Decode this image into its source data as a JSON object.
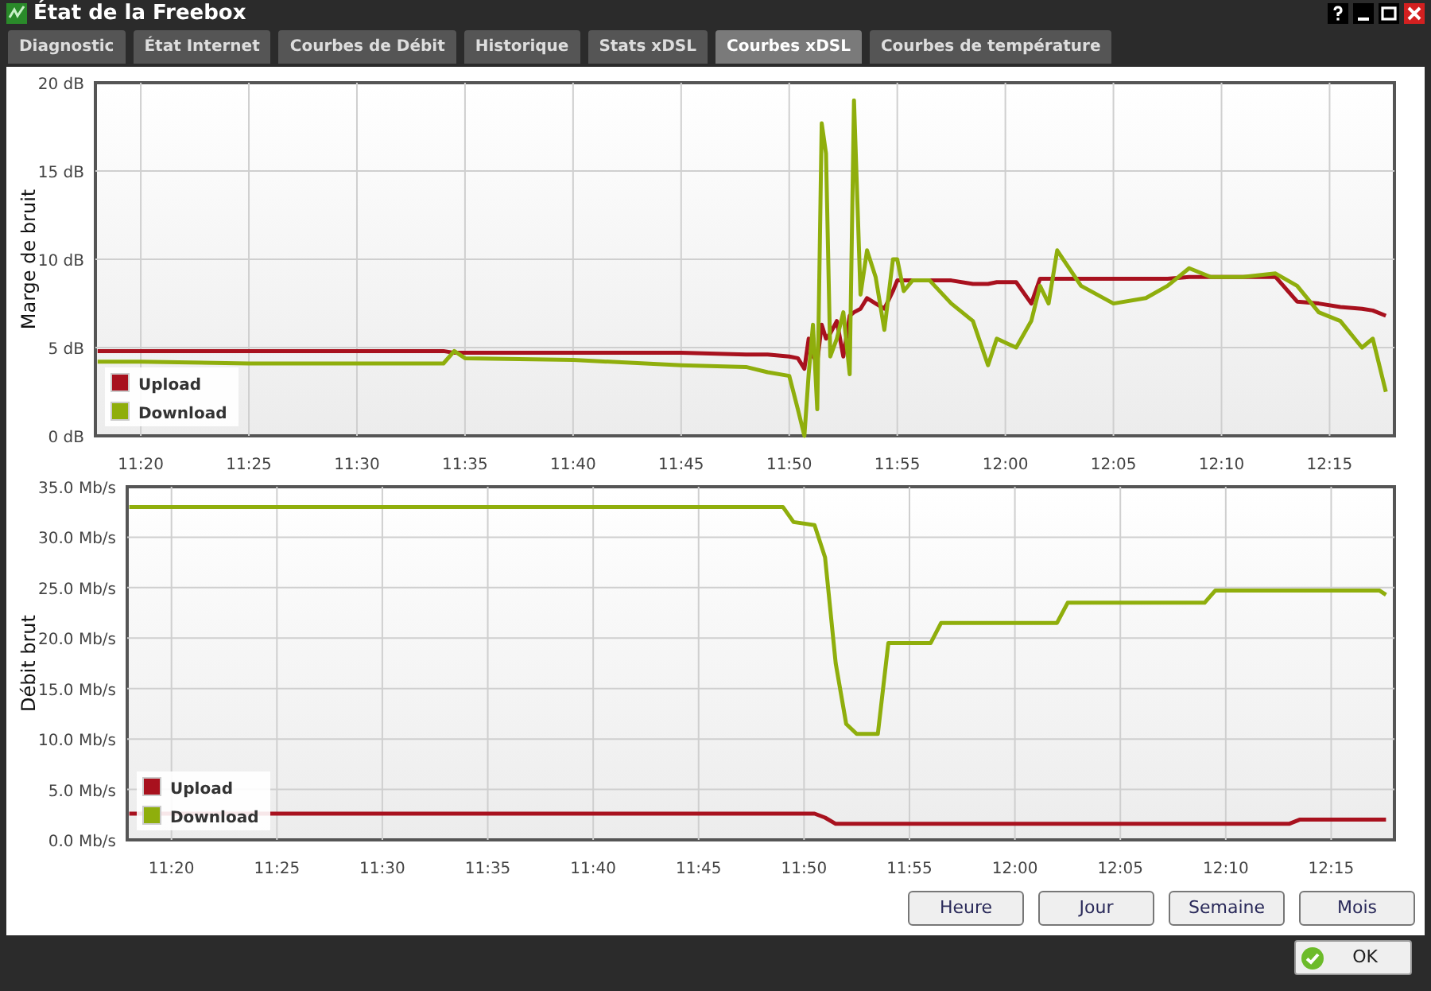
{
  "window": {
    "title": "État de la Freebox"
  },
  "tabs": [
    {
      "label": "Diagnostic",
      "selected": false
    },
    {
      "label": "État Internet",
      "selected": false
    },
    {
      "label": "Courbes de Débit",
      "selected": false
    },
    {
      "label": "Historique",
      "selected": false
    },
    {
      "label": "Stats xDSL",
      "selected": false
    },
    {
      "label": "Courbes xDSL",
      "selected": true
    },
    {
      "label": "Courbes de température",
      "selected": false
    }
  ],
  "charts": [
    {
      "chart_data": {
        "type": "line",
        "grid": true,
        "legend": true,
        "ylabel": "Marge de bruit",
        "xlim": [
          677.9,
          738
        ],
        "ylim": [
          0,
          20
        ],
        "yticks": [
          {
            "value": 0,
            "label": "0 dB"
          },
          {
            "value": 5,
            "label": "5 dB"
          },
          {
            "value": 10,
            "label": "10 dB"
          },
          {
            "value": 15,
            "label": "15 dB"
          },
          {
            "value": 20,
            "label": "20 dB"
          }
        ],
        "xticks": [
          {
            "value": 680,
            "label": "11:20"
          },
          {
            "value": 685,
            "label": "11:25"
          },
          {
            "value": 690,
            "label": "11:30"
          },
          {
            "value": 695,
            "label": "11:35"
          },
          {
            "value": 700,
            "label": "11:40"
          },
          {
            "value": 705,
            "label": "11:45"
          },
          {
            "value": 710,
            "label": "11:50"
          },
          {
            "value": 715,
            "label": "11:55"
          },
          {
            "value": 720,
            "label": "12:00"
          },
          {
            "value": 725,
            "label": "12:05"
          },
          {
            "value": 730,
            "label": "12:10"
          },
          {
            "value": 735,
            "label": "12:15"
          }
        ],
        "x": [
          678,
          680,
          685,
          690,
          694,
          694.5,
          695,
          700,
          705,
          708,
          709,
          710,
          710.4,
          710.7,
          710.9,
          711.1,
          711.3,
          711.5,
          711.7,
          711.9,
          712.2,
          712.5,
          712.8,
          713,
          713.3,
          713.6,
          714,
          714.4,
          714.8,
          715,
          715.3,
          715.7,
          716.5,
          717.5,
          718.5,
          719.2,
          719.6,
          720.5,
          721.2,
          721.6,
          722,
          722.4,
          723.5,
          725,
          726.5,
          727.5,
          728.5,
          729.5,
          731,
          732.5,
          733.5,
          734.5,
          735.5,
          736.5,
          737,
          737.6
        ],
        "series": [
          {
            "name": "Upload",
            "color": "#a8111e",
            "values": [
              4.8,
              4.8,
              4.8,
              4.8,
              4.8,
              4.7,
              4.7,
              4.7,
              4.7,
              4.6,
              4.6,
              4.5,
              4.4,
              3.8,
              5.5,
              4.5,
              4.2,
              6.3,
              5.5,
              5.8,
              6.5,
              4.5,
              6.8,
              7,
              7.2,
              7.8,
              7.5,
              7.2,
              8.2,
              8.8,
              8.8,
              8.8,
              8.8,
              8.8,
              8.6,
              8.6,
              8.7,
              8.7,
              7.5,
              8.9,
              8.9,
              8.9,
              8.9,
              8.9,
              8.9,
              8.9,
              9,
              9,
              9,
              9,
              7.6,
              7.5,
              7.3,
              7.2,
              7.1,
              6.8
            ]
          },
          {
            "name": "Download",
            "color": "#8fae0c",
            "values": [
              4.2,
              4.2,
              4.1,
              4.1,
              4.1,
              4.8,
              4.4,
              4.3,
              4,
              3.9,
              3.6,
              3.4,
              1.5,
              0,
              3.5,
              6.3,
              1.5,
              17.7,
              16,
              4.5,
              5.5,
              7,
              3.5,
              19,
              8,
              10.5,
              9,
              6,
              10,
              10,
              8.2,
              8.8,
              8.8,
              7.5,
              6.5,
              4,
              5.5,
              5,
              6.5,
              8.5,
              7.5,
              10.5,
              8.5,
              7.5,
              7.8,
              8.5,
              9.5,
              9,
              9,
              9.2,
              8.5,
              7,
              6.5,
              5,
              5.5,
              2.5
            ]
          }
        ]
      }
    },
    {
      "chart_data": {
        "type": "line",
        "grid": true,
        "legend": true,
        "ylabel": "Débit brut",
        "xlim": [
          677.9,
          738
        ],
        "ylim": [
          0,
          35
        ],
        "yticks": [
          {
            "value": 0,
            "label": "0.0 Mb/s"
          },
          {
            "value": 5,
            "label": "5.0 Mb/s"
          },
          {
            "value": 10,
            "label": "10.0 Mb/s"
          },
          {
            "value": 15,
            "label": "15.0 Mb/s"
          },
          {
            "value": 20,
            "label": "20.0 Mb/s"
          },
          {
            "value": 25,
            "label": "25.0 Mb/s"
          },
          {
            "value": 30,
            "label": "30.0 Mb/s"
          },
          {
            "value": 35,
            "label": "35.0 Mb/s"
          }
        ],
        "xticks": [
          {
            "value": 680,
            "label": "11:20"
          },
          {
            "value": 685,
            "label": "11:25"
          },
          {
            "value": 690,
            "label": "11:30"
          },
          {
            "value": 695,
            "label": "11:35"
          },
          {
            "value": 700,
            "label": "11:40"
          },
          {
            "value": 705,
            "label": "11:45"
          },
          {
            "value": 710,
            "label": "11:50"
          },
          {
            "value": 715,
            "label": "11:55"
          },
          {
            "value": 720,
            "label": "12:00"
          },
          {
            "value": 725,
            "label": "12:05"
          },
          {
            "value": 730,
            "label": "12:10"
          },
          {
            "value": 735,
            "label": "12:15"
          }
        ],
        "x": [
          678,
          709,
          709.5,
          710.5,
          711,
          711.5,
          712,
          712.5,
          713.5,
          714,
          716,
          716.5,
          722,
          722.5,
          729,
          729.5,
          733,
          733.5,
          737.3,
          737.6
        ],
        "series": [
          {
            "name": "Upload",
            "color": "#a8111e",
            "values": [
              2.6,
              2.6,
              2.6,
              2.6,
              2.2,
              1.6,
              1.6,
              1.6,
              1.6,
              1.6,
              1.6,
              1.6,
              1.6,
              1.6,
              1.6,
              1.6,
              1.6,
              2,
              2,
              2
            ]
          },
          {
            "name": "Download",
            "color": "#8fae0c",
            "values": [
              33,
              33,
              31.5,
              31.2,
              28,
              17.5,
              11.5,
              10.5,
              10.5,
              19.5,
              19.5,
              21.5,
              21.5,
              23.5,
              23.5,
              24.7,
              24.7,
              24.7,
              24.7,
              24.3
            ]
          }
        ]
      }
    }
  ],
  "range_buttons": [
    "Heure",
    "Jour",
    "Semaine",
    "Mois"
  ],
  "ok_button": "OK"
}
